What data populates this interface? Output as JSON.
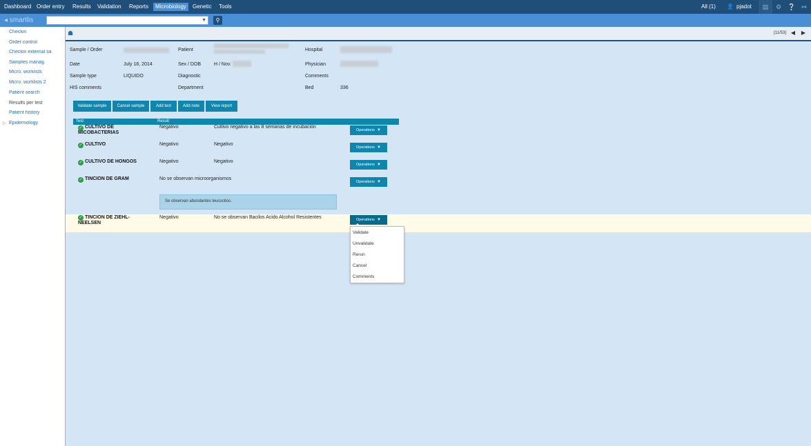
{
  "topnav": {
    "items": [
      "Dashboard",
      "Order entry",
      "Results",
      "Validation",
      "Reports",
      "Microbiology",
      "Genetic",
      "Tools"
    ],
    "all_label": "All (1)",
    "user": "pjadot"
  },
  "brand": "smartlis",
  "sidebar": {
    "items": [
      "Checkin",
      "Order control",
      "Checkin external sa",
      "Samples manag.",
      "Micro. worklists",
      "Micro. worklists 2",
      "Patient search",
      "Results per test",
      "Patient history",
      "Epidemiology"
    ]
  },
  "toolbar": {
    "pager": "[11/53]"
  },
  "sample": {
    "sample_order_label": "Sample / Order",
    "patient_label": "Patient",
    "hospital_label": "Hospital",
    "date_label": "Date",
    "date_value": "July 18, 2014",
    "sexdob_label": "Sex / DOB",
    "sexdob_value": "H / Nov.",
    "physician_label": "Physician",
    "sample_type_label": "Sample type",
    "sample_type_value": "LIQUIDO",
    "diagnostic_label": "Diagnostic",
    "comments_label": "Comments",
    "his_comments_label": "HIS comments",
    "department_label": "Department",
    "bed_label": "Bed",
    "bed_value": "336"
  },
  "actions": [
    "Validate sample",
    "Cancel sample",
    "Add test",
    "Add note",
    "View report"
  ],
  "table": {
    "col_test": "Test",
    "col_result": "Result",
    "rows": [
      {
        "name_line1": "CULTIVO DE",
        "name_line2": "MICOBACTERIAS",
        "result": "Negativo",
        "comment": "Cultivo negativo a las 8 semanas de incubación"
      },
      {
        "name_line1": "CULTIVO",
        "name_line2": "",
        "result": "Negativo",
        "comment": "Negativo"
      },
      {
        "name_line1": "CULTIVO DE HONGOS",
        "name_line2": "",
        "result": "Negativo",
        "comment": "Negativo"
      },
      {
        "name_line1": "TINCION DE GRAM",
        "name_line2": "",
        "result": "No se observan microorganismos",
        "comment": ""
      },
      {
        "name_line1": "TINCION DE ZIEHL-",
        "name_line2": "NEELSEN",
        "result": "Negativo",
        "comment": "No se observan Bacilos Acido Alcohol Resistentes"
      }
    ],
    "note": "Se observan abundantes leucocitos."
  },
  "operations_label": "Operations",
  "menu": [
    "Validate",
    "Unvalidate",
    "Rerun",
    "Cancel",
    "Comments"
  ]
}
